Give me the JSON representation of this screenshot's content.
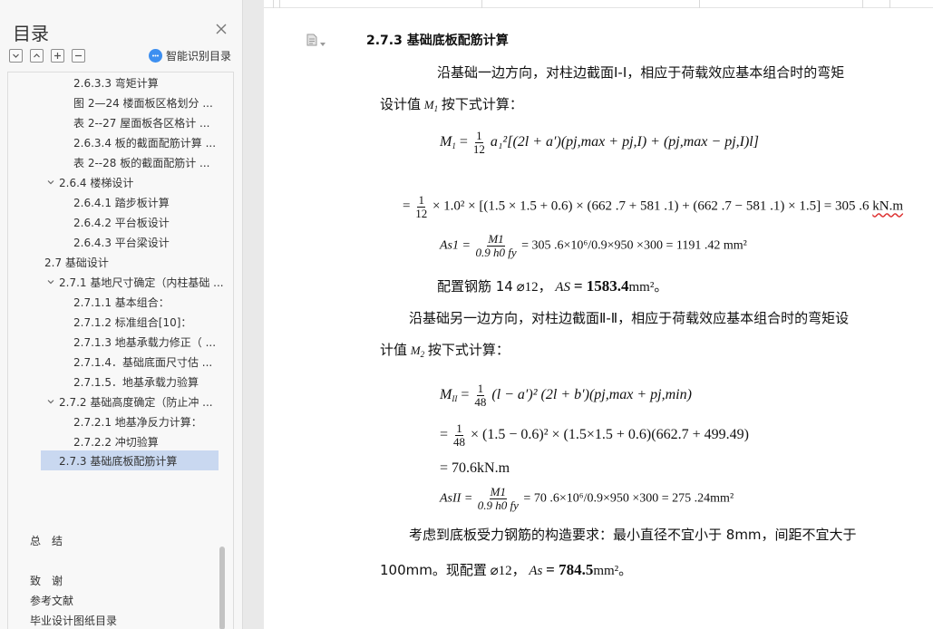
{
  "sidebar": {
    "title": "目录",
    "smart_toc_label": "智能识别目录",
    "items": [
      {
        "label": "2.6.3.3 弯矩计算"
      },
      {
        "label": "图 2—24 楼面板区格划分 ..."
      },
      {
        "label": "表 2--27 屋面板各区格计 ..."
      },
      {
        "label": "2.6.3.4 板的截面配筋计算 ..."
      },
      {
        "label": "表 2--28 板的截面配筋计 ..."
      },
      {
        "label": "2.6.4 楼梯设计"
      },
      {
        "label": "2.6.4.1 踏步板计算"
      },
      {
        "label": "2.6.4.2 平台板设计"
      },
      {
        "label": "2.6.4.3 平台梁设计"
      },
      {
        "label": "2.7 基础设计"
      },
      {
        "label": "2.7.1 基地尺寸确定（内柱基础 ..."
      },
      {
        "label": "2.7.1.1 基本组合："
      },
      {
        "label": "2.7.1.2 标准组合[10]："
      },
      {
        "label": "2.7.1.3 地基承载力修正（ ..."
      },
      {
        "label": "2.7.1.4．基础底面尺寸估 ..."
      },
      {
        "label": "2.7.1.5．地基承载力验算"
      },
      {
        "label": "2.7.2 基础高度确定（防止冲 ..."
      },
      {
        "label": "2.7.2.1 地基净反力计算："
      },
      {
        "label": "2.7.2.2 冲切验算"
      },
      {
        "label": "2.7.3 基础底板配筋计算"
      },
      {
        "label": "总　结"
      },
      {
        "label": "致　谢"
      },
      {
        "label": "参考文献"
      },
      {
        "label": "毕业设计图纸目录"
      }
    ]
  },
  "doc": {
    "heading": "2.7.3 基础底板配筋计算",
    "p1_a": "沿基础一边方向，对柱边截面Ⅰ-Ⅰ，相应于荷载效应基本组合时的弯矩",
    "p1_b1": "设计值",
    "p1_b_var": "M",
    "p1_b_sub": "1",
    "p1_b2": "按下式计算：",
    "eq1_lhs": "M",
    "eq1_lhs_sub": "1",
    "eq1_frac_num": "1",
    "eq1_frac_den": "12",
    "eq1_rest": "a₁²[(2l + a′)(pj,max + pj,I) + (pj,max − pj,I)l]",
    "eq2_lead": "=",
    "eq2_frac_num": "1",
    "eq2_frac_den": "12",
    "eq2_rest": "× 1.0² × [(1.5 × 1.5 + 0.6) × (662 .7 + 581 .1) + (662 .7 − 581 .1) × 1.5] = 305 .6",
    "eq2_unit": "kN.m",
    "eq3_lhs": "As1 =",
    "eq3_num": "M1",
    "eq3_den": "0.9 h0 fy",
    "eq3_rest": "= 305 .6×10⁶/0.9×950 ×300 = 1191 .42 mm²",
    "p2_pre": "配置钢筋 14",
    "p2_bar": "⌀12，",
    "p2_var": "AS",
    "p2_value": "= 1583.4",
    "p2_unit": "mm²。",
    "p3_a": "沿基础另一边方向，对柱边截面Ⅱ-Ⅱ，相应于荷载效应基本组合时的弯矩设",
    "p3_b1": "计值",
    "p3_b_var": "M",
    "p3_b_sub": "2",
    "p3_b2": "按下式计算：",
    "eq4_lhs": "M",
    "eq4_lhs_sub": "II",
    "eq4_frac_num": "1",
    "eq4_frac_den": "48",
    "eq4_rest": "(l − a′)² (2l + b′)(pj,max + pj,min)",
    "eq5_lead": "=",
    "eq5_frac_num": "1",
    "eq5_frac_den": "48",
    "eq5_rest": "× (1.5 − 0.6)² × (1.5×1.5 + 0.6)(662.7 + 499.49)",
    "eq6": "= 70.6kN.m",
    "eq7_lhs": "AsII =",
    "eq7_num": "M1",
    "eq7_den": "0.9 h0 fy",
    "eq7_rest": "= 70 .6×10⁶/0.9×950 ×300 = 275 .24mm²",
    "p4_a": "考虑到底板受力钢筋的构造要求：最小直径不宜小于 8mm，间距不宜大于",
    "p4_b1": "100mm。现配置",
    "p4_bar": "⌀12，",
    "p4_var": "As",
    "p4_value": "= 784.5",
    "p4_unit": "mm²。"
  }
}
